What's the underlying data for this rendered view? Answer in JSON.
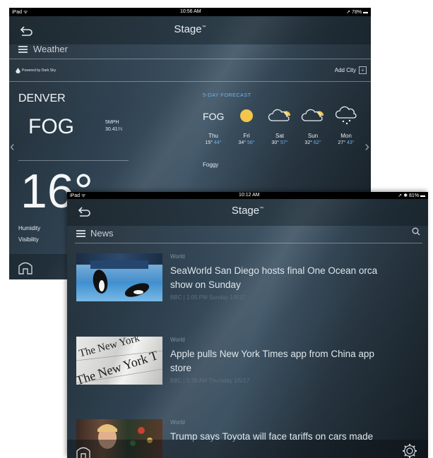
{
  "weather_screen": {
    "status": {
      "device": "iPad ᯤ",
      "time": "10:56 AM",
      "battery": "➚ 78% ▬"
    },
    "app_title": "Stage",
    "app_title_mark": "™",
    "section_title": "Weather",
    "powered_by": "Powered by Dark Sky",
    "add_city_label": "Add City",
    "city": "DENVER",
    "condition": "FOG",
    "wind": "5MPH",
    "pressure_value": "30.41",
    "pressure_unit": "IN",
    "temperature": "16°",
    "details": [
      "Humidity",
      "Visibility"
    ],
    "forecast_title": "5-DAY FORECAST",
    "forecast_now": "FOG",
    "forecast": [
      {
        "day": "Thu",
        "high": "15°",
        "low": "44°",
        "icon": "sun-icon"
      },
      {
        "day": "Fri",
        "high": "34°",
        "low": "56°",
        "icon": "sun-icon"
      },
      {
        "day": "Sat",
        "high": "30°",
        "low": "57°",
        "icon": "partly-cloudy-icon"
      },
      {
        "day": "Sun",
        "high": "32°",
        "low": "62°",
        "icon": "partly-cloudy-icon"
      },
      {
        "day": "Mon",
        "high": "27°",
        "low": "43°",
        "icon": "snow-cloud-icon"
      }
    ],
    "summary": "Foggy"
  },
  "news_screen": {
    "status": {
      "device": "iPad ᯤ",
      "time": "10:12 AM",
      "battery": "➚ ✱ 81% ▬"
    },
    "app_title": "Stage",
    "app_title_mark": "™",
    "section_title": "News",
    "articles": [
      {
        "category": "World",
        "headline": "SeaWorld San Diego hosts final One Ocean orca show on Sunday",
        "meta": "BBC | 1:05 PM Sunday 1/8/17"
      },
      {
        "category": "World",
        "headline": "Apple pulls New York Times app from China app store",
        "meta": "BBC | 5:38 AM Thursday 1/5/17"
      },
      {
        "category": "World",
        "headline": "Trump says Toyota will face tariffs on cars made",
        "meta": ""
      }
    ]
  },
  "colors": {
    "accent_blue": "#6fb1e8",
    "sun_yellow": "#f3c64a",
    "panel_dark": "#24323c"
  }
}
